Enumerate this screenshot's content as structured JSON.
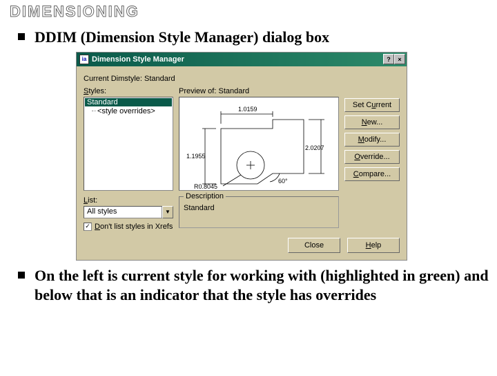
{
  "slide": {
    "title": "DIMENSIONING",
    "bullet1": "DDIM (Dimension Style Manager) dialog box",
    "bullet2": "On the left is current style for working  with (highlighted in green) and below that  is an indicator that the style has overrides"
  },
  "dialog": {
    "titlebar_icon": "ia",
    "title": "Dimension Style Manager",
    "current_label": "Current Dimstyle:",
    "current_value": "Standard",
    "styles_label": "Styles:",
    "styles": {
      "selected": "Standard",
      "child": "<style overrides>"
    },
    "preview_label_prefix": "Preview of:",
    "preview_label_value": "Standard",
    "preview_dims": {
      "top": "1.0159",
      "left": "1.1955",
      "right": "2.0207",
      "angle": "60°",
      "radius": "R0.8045"
    },
    "buttons": {
      "set_current": "Set Current",
      "new": "New...",
      "modify": "Modify...",
      "override": "Override...",
      "compare": "Compare..."
    },
    "list_label": "List:",
    "list_value": "All styles",
    "xref_check": "Don't list styles in Xrefs",
    "xref_checked": "✓",
    "desc_label": "Description",
    "desc_value": "Standard",
    "close": "Close",
    "help": "Help"
  }
}
